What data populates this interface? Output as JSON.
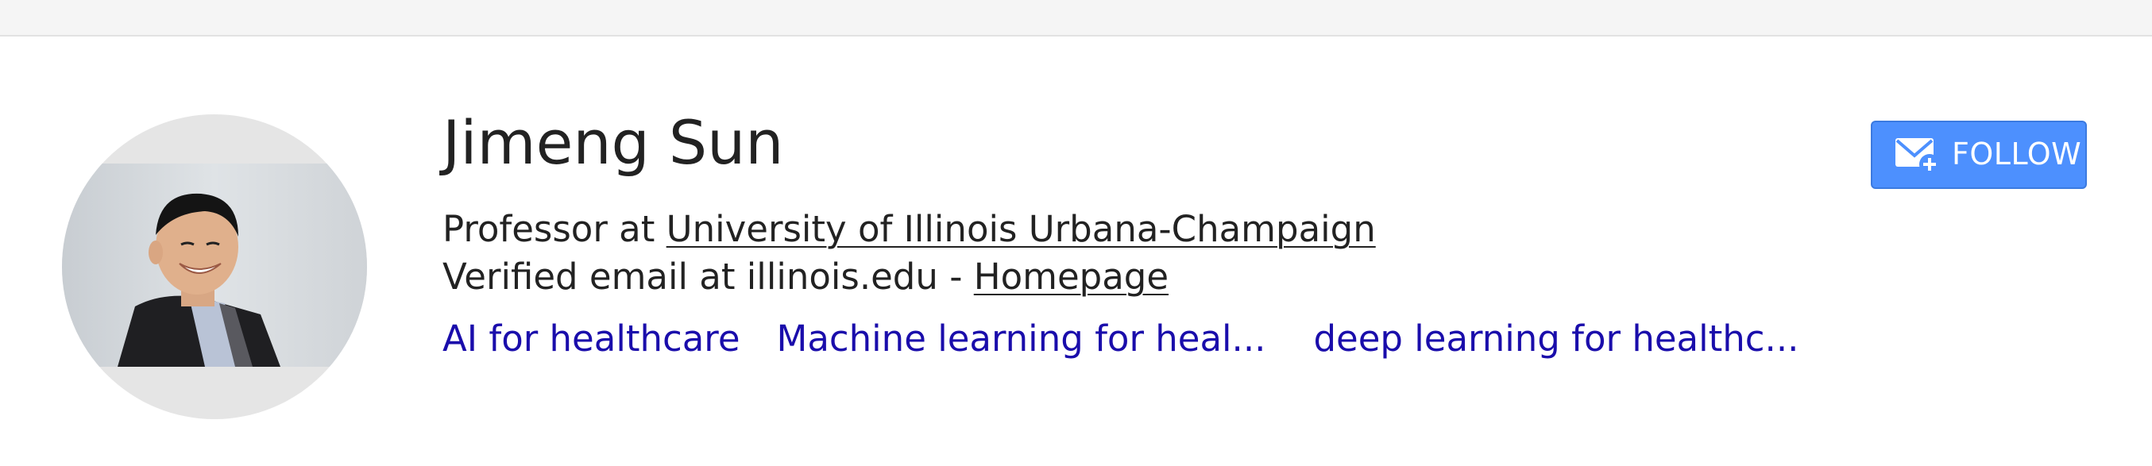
{
  "profile": {
    "name": "Jimeng Sun",
    "affiliation_prefix": "Professor at ",
    "affiliation_link": "University of Illinois Urbana-Champaign",
    "email_text": "Verified email at illinois.edu - ",
    "homepage_link": "Homepage",
    "interests": [
      "AI for healthcare",
      "Machine learning for heal...",
      "deep learning for healthc..."
    ]
  },
  "follow": {
    "label": "FOLLOW",
    "icon": "mail-plus-icon"
  },
  "colors": {
    "accent": "#4d90fe",
    "link": "#1a0dab",
    "text": "#222222",
    "topbar": "#f5f5f5"
  }
}
